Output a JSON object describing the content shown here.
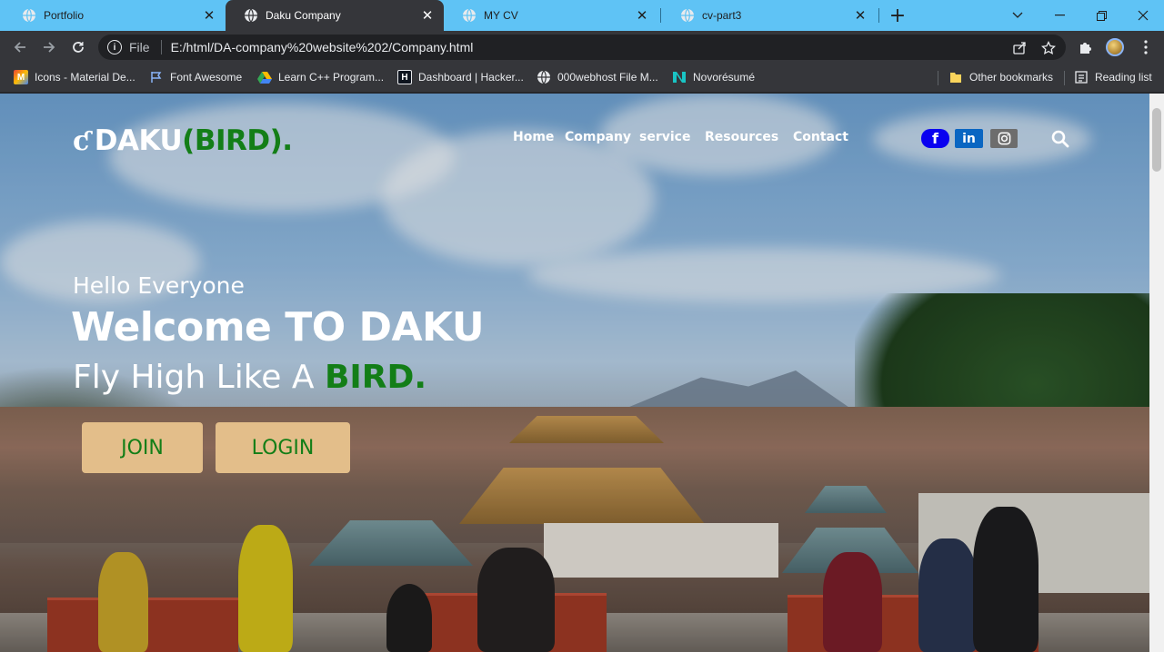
{
  "browser": {
    "tabs": [
      {
        "title": "Portfolio",
        "active": false
      },
      {
        "title": "Daku Company",
        "active": true
      },
      {
        "title": "MY CV",
        "active": false
      },
      {
        "title": "cv-part3",
        "active": false
      }
    ],
    "new_tab_glyph": "+",
    "omnibox": {
      "scheme_label": "File",
      "url": "E:/html/DA-company%20website%202/Company.html"
    },
    "bookmarks": [
      {
        "label": "Icons - Material De...",
        "icon": "material-icon"
      },
      {
        "label": "Font Awesome",
        "icon": "flag-icon"
      },
      {
        "label": "Learn C++ Program...",
        "icon": "drive-icon"
      },
      {
        "label": "Dashboard | Hacker...",
        "icon": "hackerrank-icon"
      },
      {
        "label": "000webhost File M...",
        "icon": "globe-icon"
      },
      {
        "label": "Novorésumé",
        "icon": "novoresume-icon"
      }
    ],
    "other_bookmarks": "Other bookmarks",
    "reading_list": "Reading list"
  },
  "site": {
    "logo": {
      "main": "DAKU",
      "accent": "(BIRD)."
    },
    "nav": [
      "Home",
      "Company",
      "service",
      "Resources",
      "Contact"
    ],
    "social": {
      "facebook": "f",
      "linkedin": "in"
    },
    "hero": {
      "greeting": "Hello Everyone",
      "headline": "Welcome TO DAKU",
      "tagline_prefix": "Fly High Like A ",
      "tagline_accent": "BIRD."
    },
    "buttons": {
      "join": "JOIN",
      "login": "LOGIN"
    }
  },
  "colors": {
    "accent_green": "#137e17",
    "button_bg": "#e3be8a",
    "facebook_blue": "#0a00f0",
    "linkedin_blue": "#0a66c2",
    "tabstrip": "#5fc3f5"
  }
}
